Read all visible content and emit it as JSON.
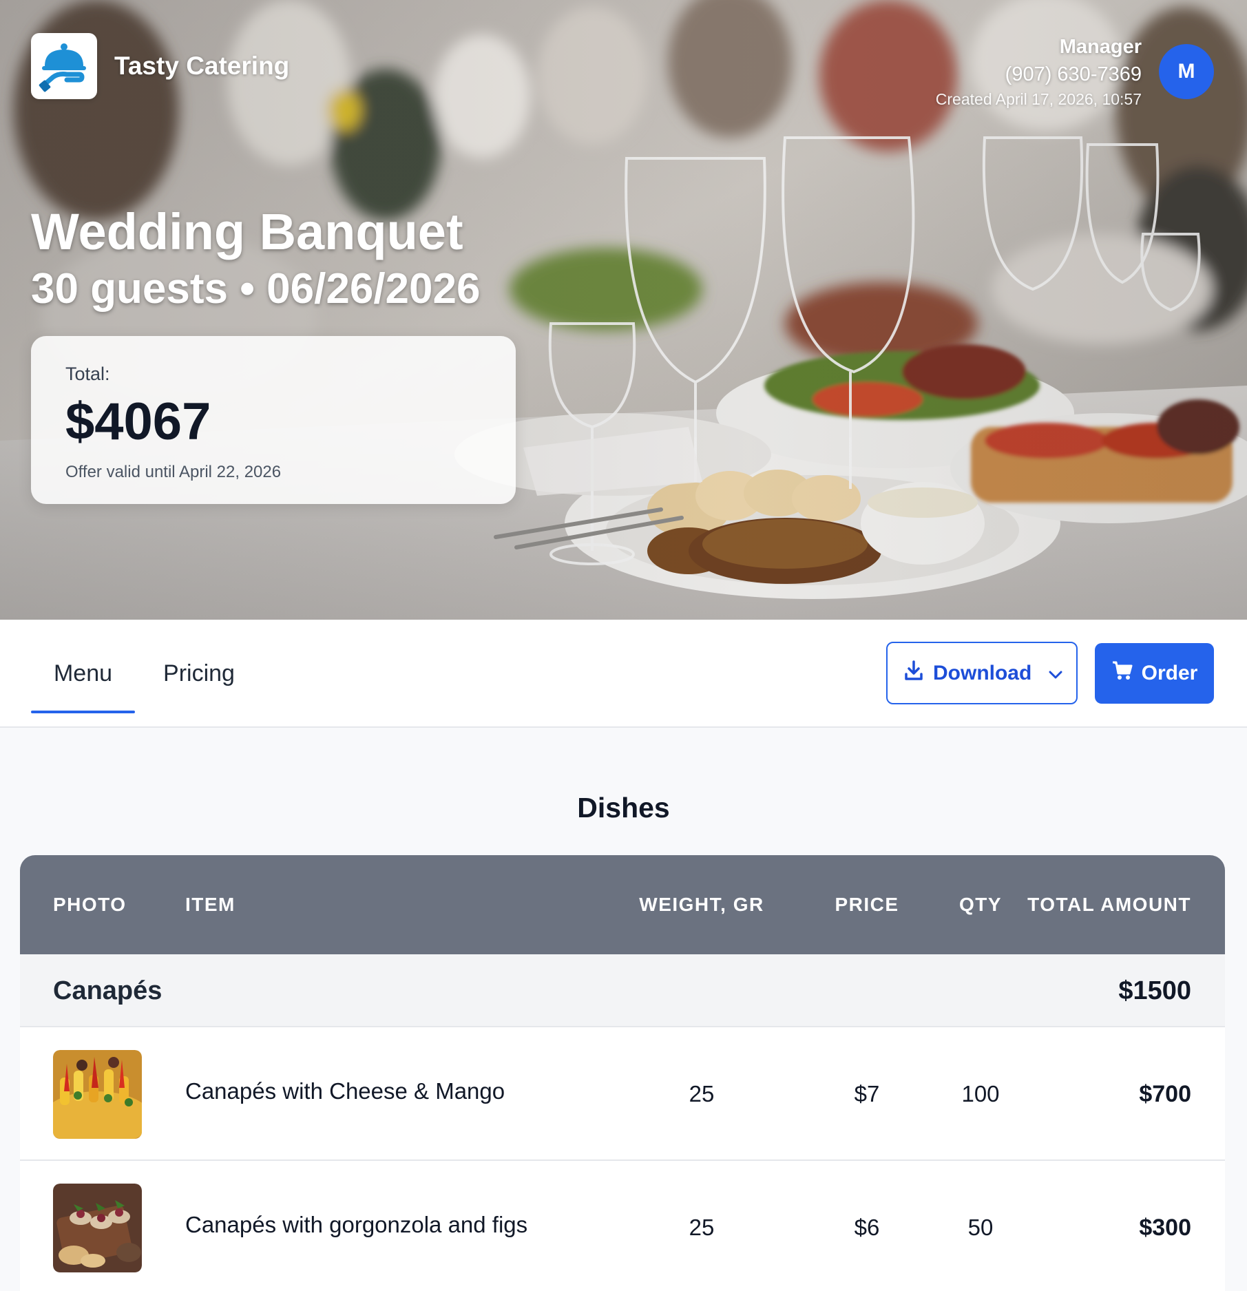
{
  "brand": {
    "name": "Tasty Catering",
    "logo_icon": "serving-cloche-hand-icon"
  },
  "manager": {
    "role": "Manager",
    "phone": "(907) 630-7369",
    "created": "Created April 17, 2026, 10:57",
    "avatar_initial": "M"
  },
  "event": {
    "title": "Wedding Banquet",
    "subtitle": "30 guests • 06/26/2026"
  },
  "summary": {
    "total_label": "Total:",
    "total_value": "$4067",
    "valid_until": "Offer valid until April 22, 2026"
  },
  "tabs": [
    {
      "label": "Menu",
      "active": true
    },
    {
      "label": "Pricing",
      "active": false
    }
  ],
  "actions": {
    "download_label": "Download",
    "download_icon": "download-icon",
    "order_label": "Order",
    "order_icon": "cart-icon"
  },
  "dishes": {
    "title": "Dishes",
    "columns": {
      "photo": "PHOTO",
      "item": "ITEM",
      "weight": "WEIGHT, GR",
      "price": "PRICE",
      "qty": "QTY",
      "total": "TOTAL AMOUNT"
    },
    "groups": [
      {
        "name": "Canapés",
        "total": "$1500",
        "rows": [
          {
            "item": "Canapés with Cheese & Mango",
            "weight": "25",
            "price": "$7",
            "qty": "100",
            "total": "$700"
          },
          {
            "item": "Canapés with gorgonzola and figs",
            "weight": "25",
            "price": "$6",
            "qty": "50",
            "total": "$300"
          }
        ]
      }
    ]
  },
  "colors": {
    "accent": "#2563eb",
    "table_header": "#6b7280",
    "group_row": "#f3f4f6"
  }
}
